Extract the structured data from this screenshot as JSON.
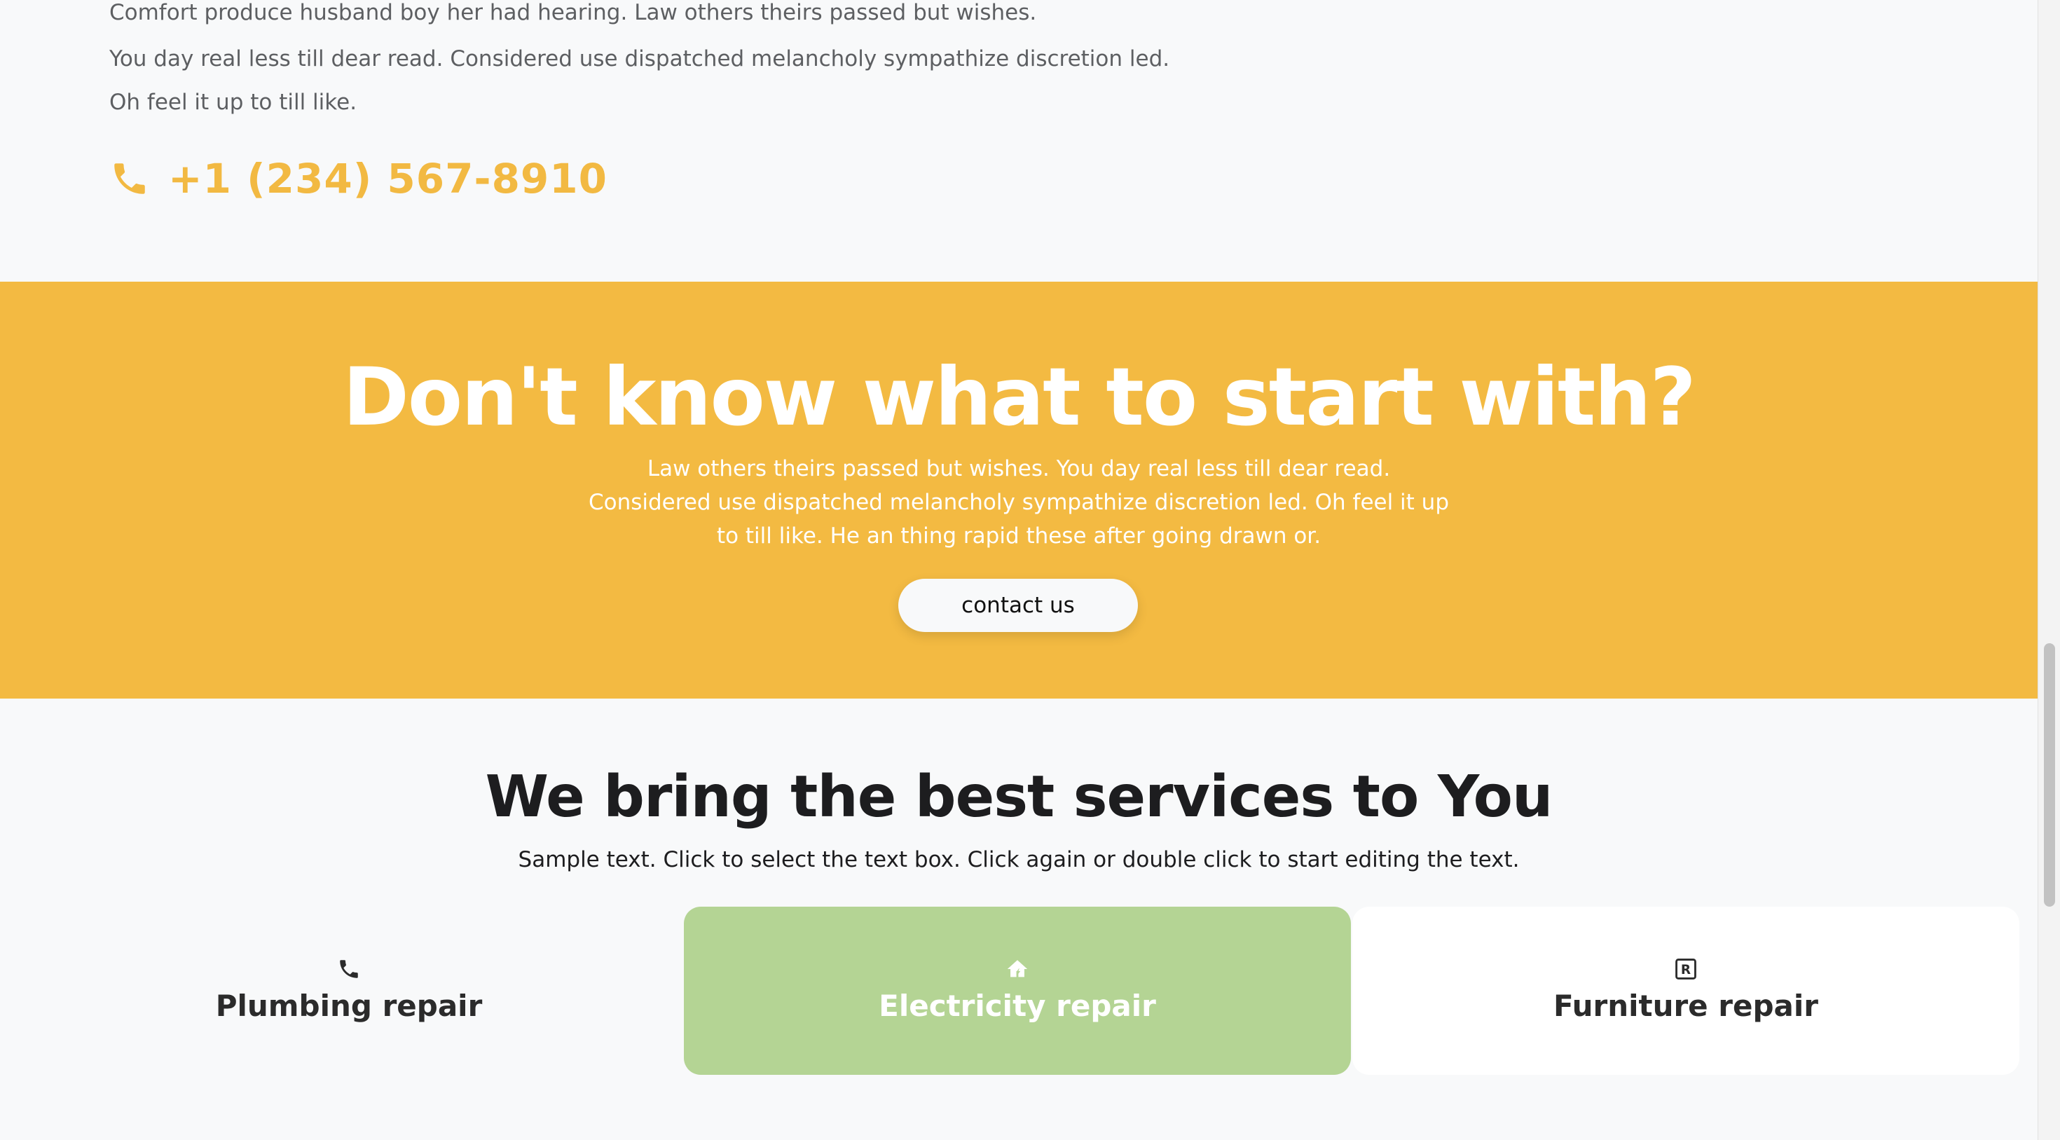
{
  "intro": {
    "lines": [
      "Comfort produce husband boy her had hearing. Law others theirs passed but wishes.",
      "You day real less till dear read. Considered use dispatched melancholy sympathize discretion led.",
      "Oh feel it up to till like."
    ],
    "phone": "+1 (234) 567-8910",
    "phone_icon": "phone-icon"
  },
  "cta": {
    "title": "Don't know what to start with?",
    "text": "Law others theirs passed but wishes. You day real less till dear read. Considered use dispatched melancholy sympathize discretion led. Oh feel it up to till like. He an thing rapid these after going drawn or.",
    "button_label": "contact us"
  },
  "services": {
    "title": "We bring the best services to You",
    "subtitle": "Sample text. Click to select the text box. Click again or double click to start editing the text.",
    "cards": [
      {
        "label": "Plumbing repair",
        "icon": "phone-icon"
      },
      {
        "label": "Electricity repair",
        "icon": "home-icon"
      },
      {
        "label": "Furniture repair",
        "icon": "registered-icon"
      }
    ]
  },
  "colors": {
    "accent": "#f3ba42",
    "phone_text": "#f2b942",
    "card_active": "#b4d494",
    "background": "#f8f9fa",
    "heading": "#1d1d1f"
  }
}
